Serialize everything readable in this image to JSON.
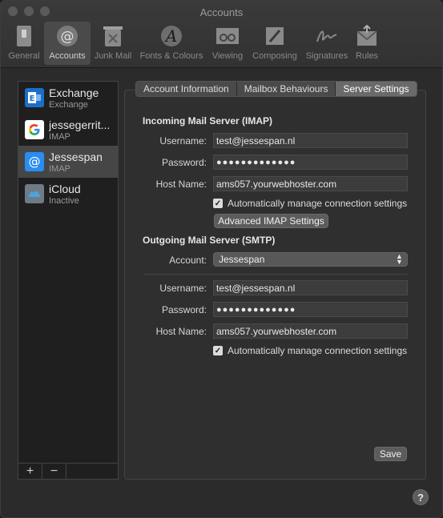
{
  "window": {
    "title": "Accounts"
  },
  "toolbar": {
    "items": [
      {
        "label": "General",
        "icon": "switch-icon"
      },
      {
        "label": "Accounts",
        "icon": "at-sign-icon"
      },
      {
        "label": "Junk Mail",
        "icon": "junk-bin-icon"
      },
      {
        "label": "Fonts & Colours",
        "icon": "font-icon"
      },
      {
        "label": "Viewing",
        "icon": "glasses-icon"
      },
      {
        "label": "Composing",
        "icon": "pen-icon"
      },
      {
        "label": "Signatures",
        "icon": "signature-icon"
      },
      {
        "label": "Rules",
        "icon": "rules-envelope-icon"
      }
    ],
    "active": "Accounts"
  },
  "accounts": [
    {
      "name": "Exchange",
      "type": "Exchange",
      "icon": "exchange-icon",
      "color": "#1c6fc9"
    },
    {
      "name": "jessegerrit...",
      "type": "IMAP",
      "icon": "google-icon",
      "color": "#ffffff"
    },
    {
      "name": "Jessespan",
      "type": "IMAP",
      "icon": "at-sign-icon",
      "color": "#2a8ef0"
    },
    {
      "name": "iCloud",
      "type": "Inactive",
      "icon": "icloud-icon",
      "color": "#6f7b86"
    }
  ],
  "sidebar_buttons": {
    "add": "+",
    "remove": "−"
  },
  "tabs": [
    {
      "label": "Account Information"
    },
    {
      "label": "Mailbox Behaviours"
    },
    {
      "label": "Server Settings"
    }
  ],
  "incoming": {
    "heading": "Incoming Mail Server (IMAP)",
    "username_label": "Username:",
    "username": "test@jessespan.nl",
    "password_label": "Password:",
    "password": "●●●●●●●●●●●●●",
    "host_label": "Host Name:",
    "host": "ams057.yourwebhoster.com",
    "auto_manage": "Automatically manage connection settings",
    "advanced_button": "Advanced IMAP Settings"
  },
  "outgoing": {
    "heading": "Outgoing Mail Server (SMTP)",
    "account_label": "Account:",
    "account": "Jessespan",
    "username_label": "Username:",
    "username": "test@jessespan.nl",
    "password_label": "Password:",
    "password": "●●●●●●●●●●●●●",
    "host_label": "Host Name:",
    "host": "ams057.yourwebhoster.com",
    "auto_manage": "Automatically manage connection settings"
  },
  "save_button": "Save",
  "help_button": "?"
}
